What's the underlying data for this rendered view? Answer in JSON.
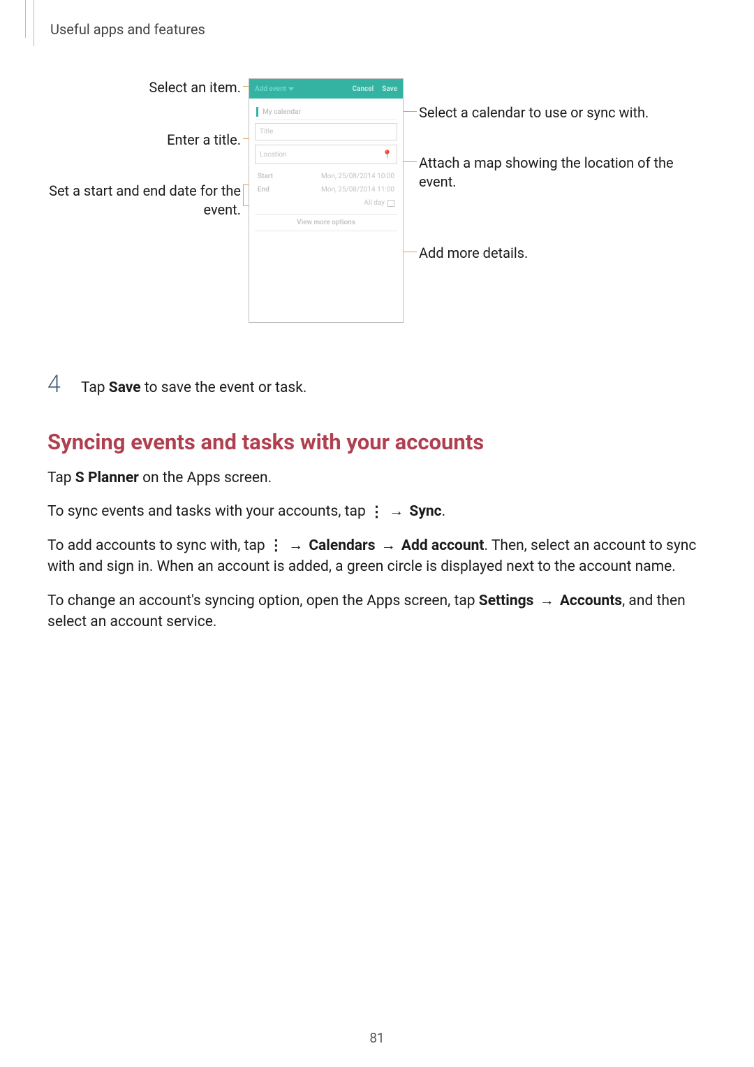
{
  "header": {
    "section_label": "Useful apps and features"
  },
  "diagram": {
    "phone": {
      "topbar": {
        "dropdown": "Add event",
        "cancel": "Cancel",
        "save": "Save"
      },
      "calendar_select": "My calendar",
      "title_placeholder": "Title",
      "location_placeholder": "Location",
      "start_label": "Start",
      "start_value": "Mon, 25/08/2014   10:00",
      "end_label": "End",
      "end_value": "Mon, 25/08/2014   11:00",
      "all_day": "All day",
      "more_options": "View more options"
    },
    "callouts": {
      "select_item": "Select an item.",
      "enter_title": "Enter a title.",
      "set_dates": "Set a start and end date for the event.",
      "select_calendar": "Select a calendar to use or sync with.",
      "attach_map": "Attach a map showing the location of the event.",
      "add_details": "Add more details."
    }
  },
  "step4": {
    "num": "4",
    "pre": "Tap ",
    "bold": "Save",
    "post": " to save the event or task."
  },
  "section": {
    "heading": "Syncing events and tasks with your accounts",
    "p1_pre": "Tap ",
    "p1_bold": "S Planner",
    "p1_post": " on the Apps screen.",
    "p2_pre": "To sync events and tasks with your accounts, tap ",
    "p2_arrow1": " → ",
    "p2_bold": "Sync",
    "p2_post": ".",
    "p3_pre": "To add accounts to sync with, tap ",
    "p3_arrow1": " → ",
    "p3_b1": "Calendars",
    "p3_arrow2": " → ",
    "p3_b2": "Add account",
    "p3_post": ". Then, select an account to sync with and sign in. When an account is added, a green circle is displayed next to the account name.",
    "p4_pre": "To change an account's syncing option, open the Apps screen, tap ",
    "p4_b1": "Settings",
    "p4_arrow": " → ",
    "p4_b2": "Accounts",
    "p4_post": ", and then select an account service."
  },
  "page_number": "81"
}
